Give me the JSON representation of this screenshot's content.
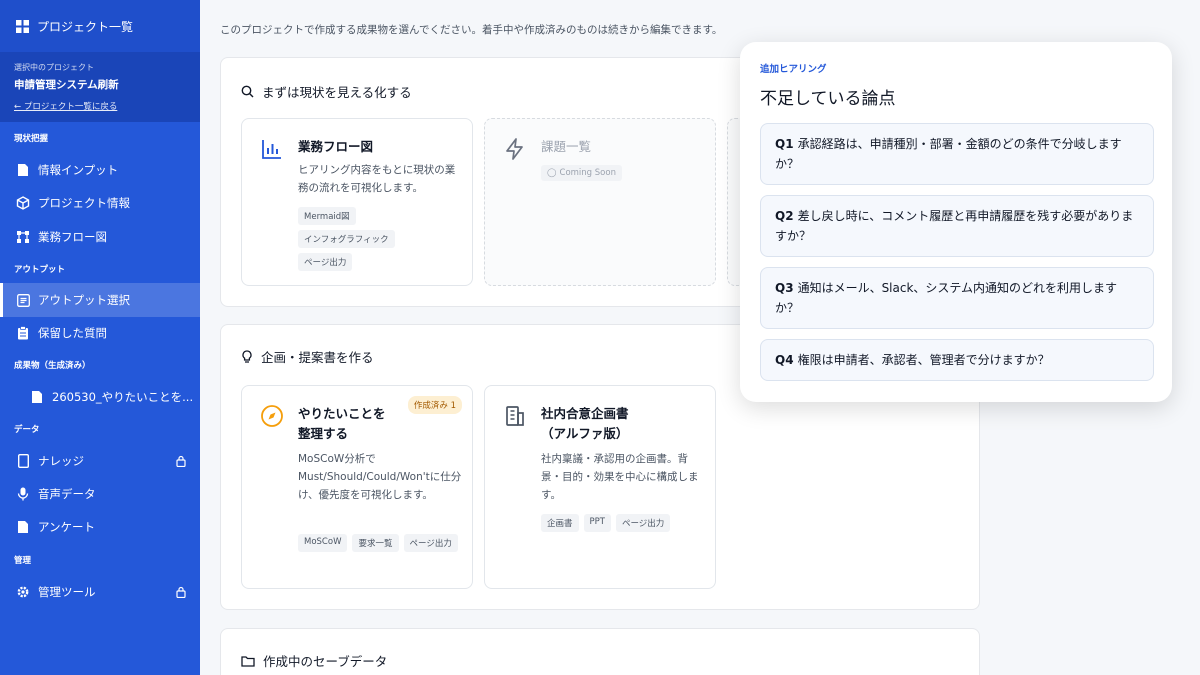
{
  "sidebar": {
    "top_label": "プロジェクト一覧",
    "project": {
      "caption": "選択中のプロジェクト",
      "name": "申請管理システム刷新",
      "back": "← プロジェクト一覧に戻る"
    },
    "sections": {
      "current": "現状把握",
      "output": "アウトプット",
      "deliverables": "成果物（生成済み）",
      "data": "データ",
      "admin": "管理"
    },
    "items": {
      "info_input": "情報インプット",
      "project_info": "プロジェクト情報",
      "business_flow": "業務フロー図",
      "output_select": "アウトプット選択",
      "saved_questions": "保留した質問",
      "deliverable_1": "260530_やりたいことを...",
      "knowledge": "ナレッジ",
      "voice_data": "音声データ",
      "survey": "アンケート",
      "admin_tools": "管理ツール"
    }
  },
  "main": {
    "intro": "このプロジェクトで作成する成果物を選んでください。着手中や作成済みのものは続きから編集できます。",
    "panel1": {
      "title": "まずは現状を見える化する",
      "cards": [
        {
          "title": "業務フロー図",
          "desc": "ヒアリング内容をもとに現状の業務の流れを可視化します。",
          "tags": [
            "Mermaid図",
            "インフォグラフィック",
            "ページ出力"
          ]
        },
        {
          "title": "課題一覧",
          "soon": "Coming Soon"
        }
      ]
    },
    "panel2": {
      "title": "企画・提案書を作る",
      "cards": [
        {
          "title_l1": "やりたいことを",
          "title_l2": "整理する",
          "badge": "作成済み 1",
          "desc": "MoSCoW分析でMust/Should/Could/Won'tに仕分け、優先度を可視化します。",
          "tags": [
            "MoSCoW",
            "要求一覧",
            "ページ出力"
          ]
        },
        {
          "title_l1": "社内合意企画書",
          "title_l2": "（アルファ版）",
          "desc": "社内稟議・承認用の企画書。背景・目的・効果を中心に構成します。",
          "tags": [
            "企画書",
            "PPT",
            "ページ出力"
          ]
        }
      ]
    },
    "panel3": {
      "title": "作成中のセーブデータ"
    }
  },
  "overlay": {
    "subtitle": "追加ヒアリング",
    "title": "不足している論点",
    "questions": [
      {
        "num": "Q1",
        "text": "承認経路は、申請種別・部署・金額のどの条件で分岐しますか？"
      },
      {
        "num": "Q2",
        "text": "差し戻し時に、コメント履歴と再申請履歴を残す必要がありますか？"
      },
      {
        "num": "Q3",
        "text": "通知はメール、Slack、システム内通知のどれを利用しますか？"
      },
      {
        "num": "Q4",
        "text": "権限は申請者、承認者、管理者で分けますか？"
      }
    ]
  },
  "colors": {
    "sidebar": "#2458d9",
    "accent": "#2458d9",
    "badge_bg": "#fdefd2",
    "badge_text": "#a35a00"
  }
}
